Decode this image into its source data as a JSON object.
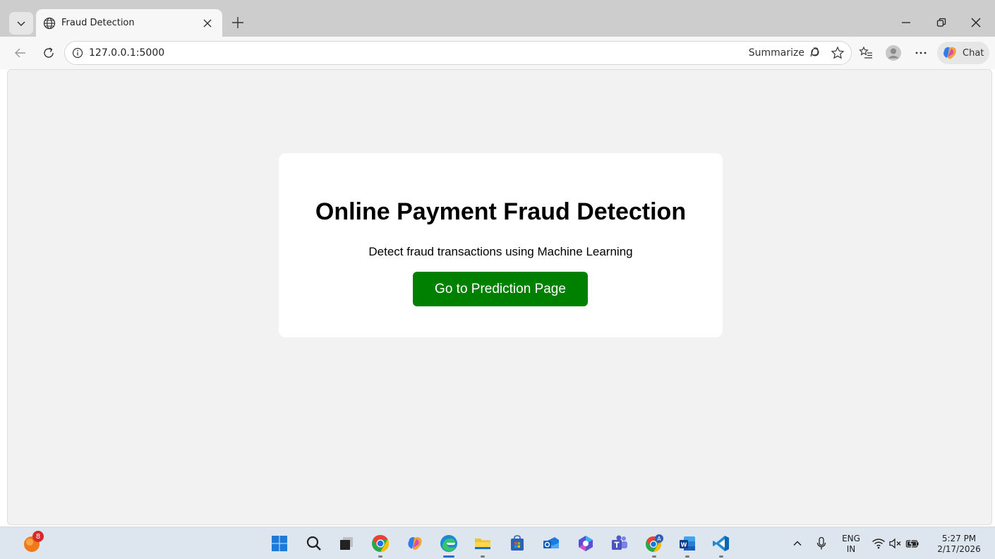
{
  "browser": {
    "tab_title": "Fraud Detection",
    "url": "127.0.0.1:5000",
    "summarize_label": "Summarize",
    "chat_label": "Chat"
  },
  "page": {
    "title": "Online Payment Fraud Detection",
    "subtitle": "Detect fraud transactions using Machine Learning",
    "button_label": "Go to Prediction Page"
  },
  "taskbar": {
    "notification_count": "8",
    "lang_primary": "ENG",
    "lang_secondary": "IN",
    "time": "5:27 PM",
    "date": "2/17/2026",
    "apps": [
      "start",
      "search",
      "task-view",
      "chrome",
      "copilot",
      "edge",
      "file-explorer",
      "store",
      "outlook",
      "m365",
      "teams",
      "chrome-profile",
      "word",
      "vscode"
    ]
  },
  "colors": {
    "button_green": "#008000",
    "page_bg": "#f2f2f2",
    "card_bg": "#ffffff",
    "tabstrip_bg": "#cdcdcd"
  }
}
